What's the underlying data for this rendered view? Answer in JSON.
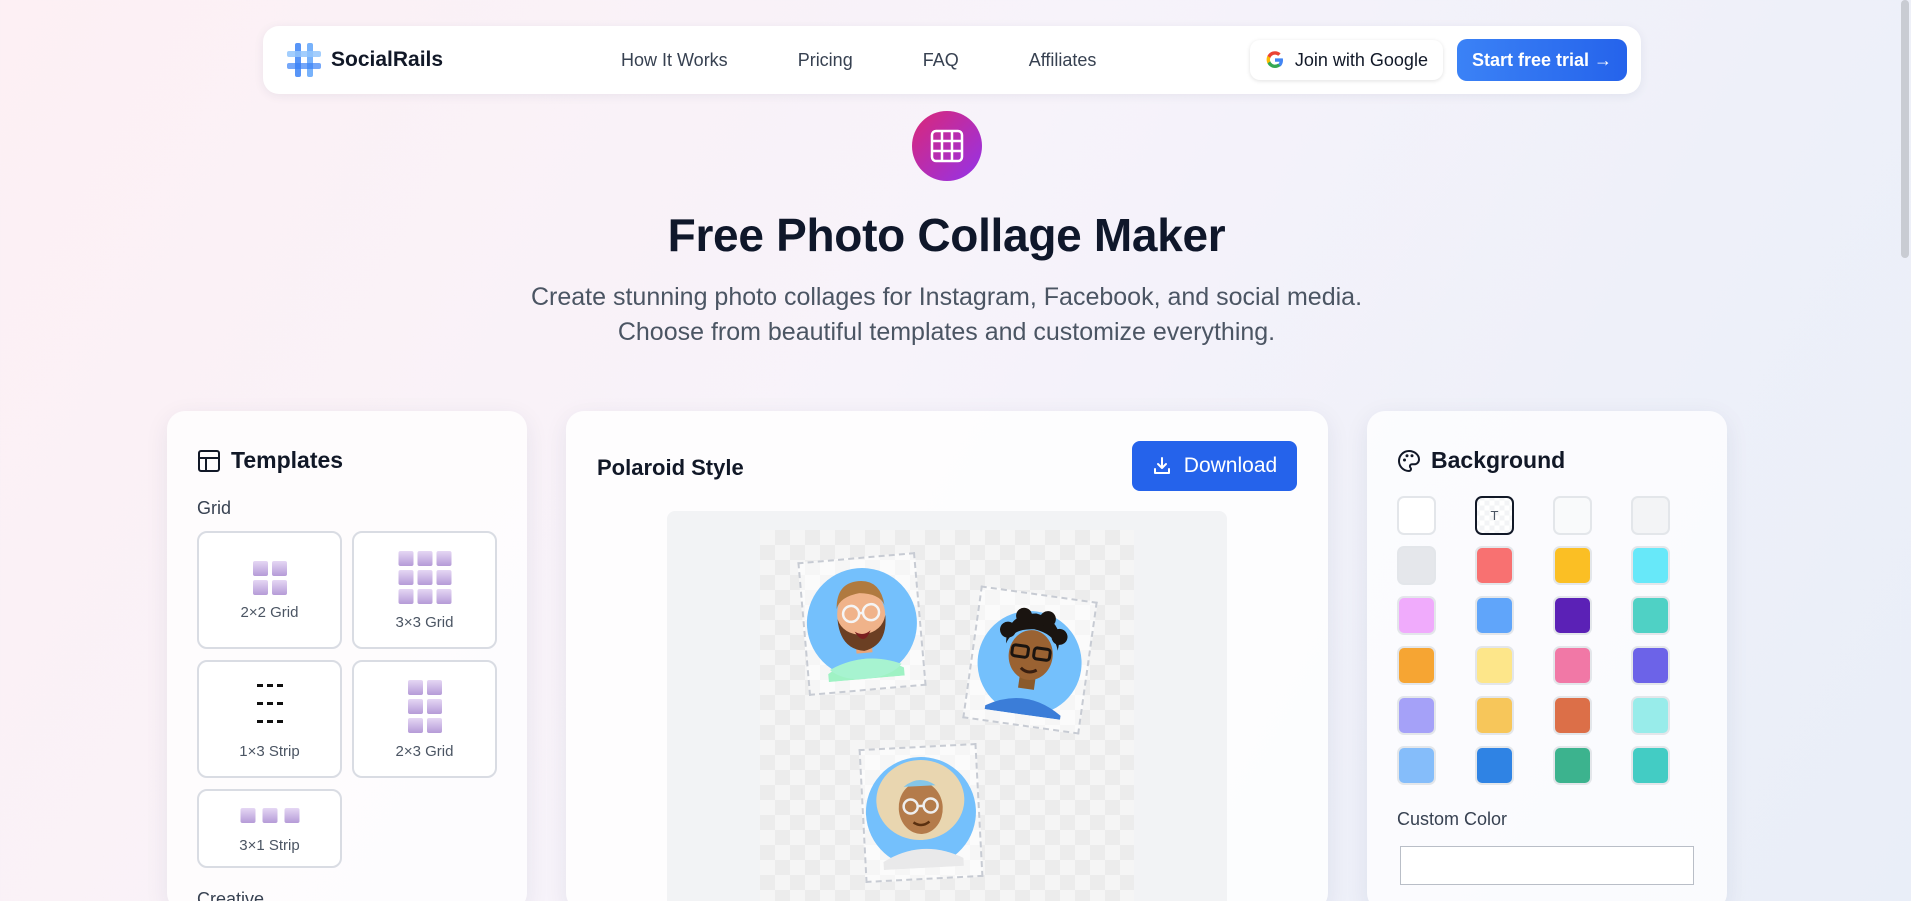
{
  "header": {
    "brand": "SocialRails",
    "nav": [
      "How It Works",
      "Pricing",
      "FAQ",
      "Affiliates"
    ],
    "google_button": "Join with Google",
    "trial_button": "Start free trial →"
  },
  "hero": {
    "title": "Free Photo Collage Maker",
    "subtitle": "Create stunning photo collages for Instagram, Facebook, and social media. Choose from beautiful templates and customize everything."
  },
  "templates": {
    "heading": "Templates",
    "section_grid": "Grid",
    "items": [
      "2×2 Grid",
      "3×3 Grid",
      "1×3 Strip",
      "2×3 Grid",
      "3×1 Strip"
    ],
    "section_creative": "Creative"
  },
  "editor": {
    "title": "Polaroid Style",
    "download_label": "Download"
  },
  "background": {
    "heading": "Background",
    "transparent_label": "T",
    "swatches": [
      "#ffffff",
      "transparent",
      "#f9fafb",
      "#f3f4f6",
      "#e5e7eb",
      "#f87171",
      "#fbbf24",
      "#67e8f9",
      "#f0abfc",
      "#60a5fa",
      "#5b21b6",
      "#4fd1c5",
      "#f6a533",
      "#fde68a",
      "#f178a6",
      "#6c63e8",
      "#a5a1f8",
      "#f7c65a",
      "#dc6f48",
      "#98ecea",
      "#85bdfa",
      "#2f83e4",
      "#3cb38e",
      "#43ccc4"
    ],
    "custom_label": "Custom Color",
    "custom_value": ""
  },
  "colors": {
    "accent": "#2563eb",
    "brand_gradient_start": "#db2777",
    "brand_gradient_end": "#9333ea"
  }
}
